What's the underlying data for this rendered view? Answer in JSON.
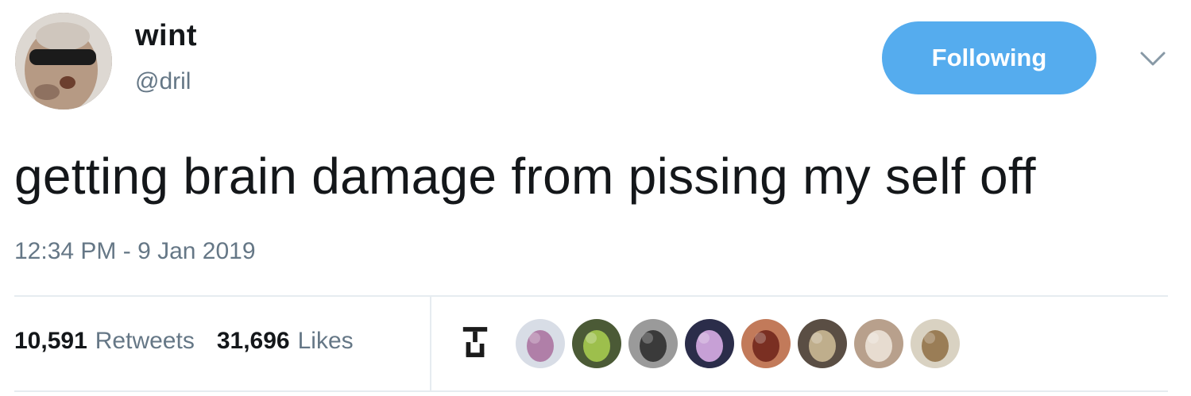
{
  "tweet": {
    "author": {
      "name": "wint",
      "handle": "@dril"
    },
    "follow_button_label": "Following",
    "text": "getting brain damage from pissing my self off",
    "timestamp": "12:34 PM - 9 Jan 2019",
    "stats": {
      "retweets_count": "10,591",
      "retweets_label": "Retweets",
      "likes_count": "31,696",
      "likes_label": "Likes"
    }
  },
  "colors": {
    "accent": "#55acee",
    "text": "#14171a",
    "secondary_text": "#657786",
    "divider": "#e6ecf0"
  },
  "icons": {
    "menu": "chevron-down-icon",
    "liker_badge": "liker-badge-icon"
  },
  "likers": [
    {
      "name": "liker-avatar-1",
      "bg": "#d8dde6",
      "fg": "#b07fa8"
    },
    {
      "name": "liker-avatar-2",
      "bg": "#4b5a36",
      "fg": "#9dbf4c"
    },
    {
      "name": "liker-avatar-3",
      "bg": "#9a9a9a",
      "fg": "#3a3a3a"
    },
    {
      "name": "liker-avatar-4",
      "bg": "#2b2d4a",
      "fg": "#c7a0d6"
    },
    {
      "name": "liker-avatar-5",
      "bg": "#c27a5a",
      "fg": "#7a2f22"
    },
    {
      "name": "liker-avatar-6",
      "bg": "#5a4e44",
      "fg": "#bfae8c"
    },
    {
      "name": "liker-avatar-7",
      "bg": "#b8a08c",
      "fg": "#e7dcd0"
    },
    {
      "name": "liker-avatar-8",
      "bg": "#d9d2c2",
      "fg": "#9a7d56"
    }
  ]
}
